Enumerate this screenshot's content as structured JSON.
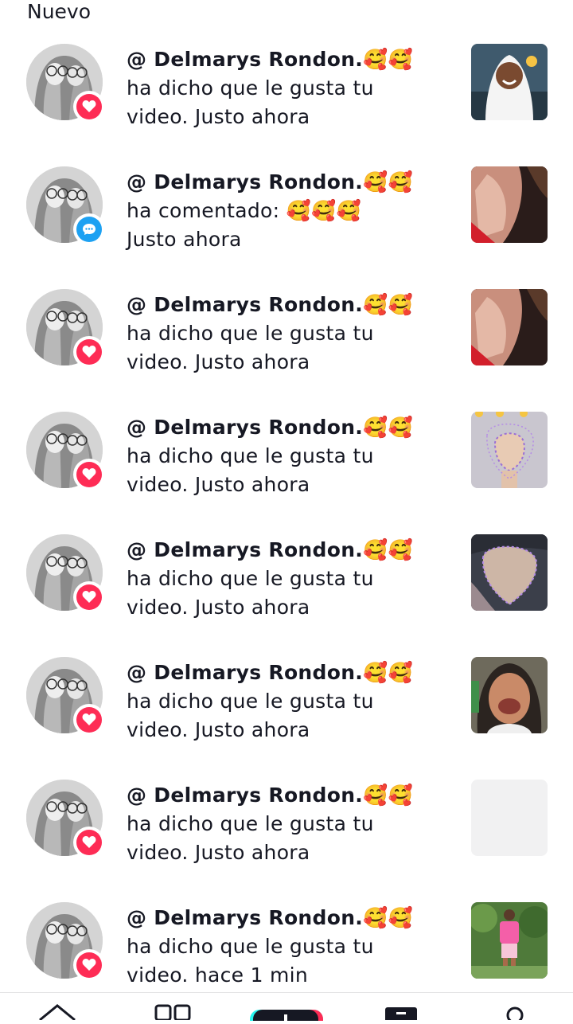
{
  "section": {
    "title": "Nuevo"
  },
  "notifications": [
    {
      "name": "@ Delmarys Rondon.🥰🥰",
      "line1": "ha dicho que le gusta tu",
      "line2": "video. Justo ahora",
      "type": "like"
    },
    {
      "name": "@ Delmarys Rondon.🥰🥰",
      "line1": "ha comentado: 🥰🥰🥰",
      "line2": " Justo ahora",
      "type": "comment"
    },
    {
      "name": "@ Delmarys Rondon.🥰🥰",
      "line1": "ha dicho que le gusta tu",
      "line2": "video. Justo ahora",
      "type": "like"
    },
    {
      "name": "@ Delmarys Rondon.🥰🥰",
      "line1": "ha dicho que le gusta tu",
      "line2": "video. Justo ahora",
      "type": "like"
    },
    {
      "name": "@ Delmarys Rondon.🥰🥰",
      "line1": "ha dicho que le gusta tu",
      "line2": "video. Justo ahora",
      "type": "like"
    },
    {
      "name": "@ Delmarys Rondon.🥰🥰",
      "line1": "ha dicho que le gusta tu",
      "line2": "video. Justo ahora",
      "type": "like"
    },
    {
      "name": "@ Delmarys Rondon.🥰🥰",
      "line1": "ha dicho que le gusta tu",
      "line2": "video. Justo ahora",
      "type": "like"
    },
    {
      "name": "@ Delmarys Rondon.🥰🥰",
      "line1": "ha dicho que le gusta tu",
      "line2": "video. hace 1 min",
      "type": "like"
    }
  ],
  "colors": {
    "like": "#fe2c55",
    "comment": "#1da1f2",
    "text": "#161823"
  },
  "tabbar": {
    "icons": [
      "home-icon",
      "discover-icon",
      "create-icon",
      "inbox-icon",
      "profile-icon"
    ]
  }
}
